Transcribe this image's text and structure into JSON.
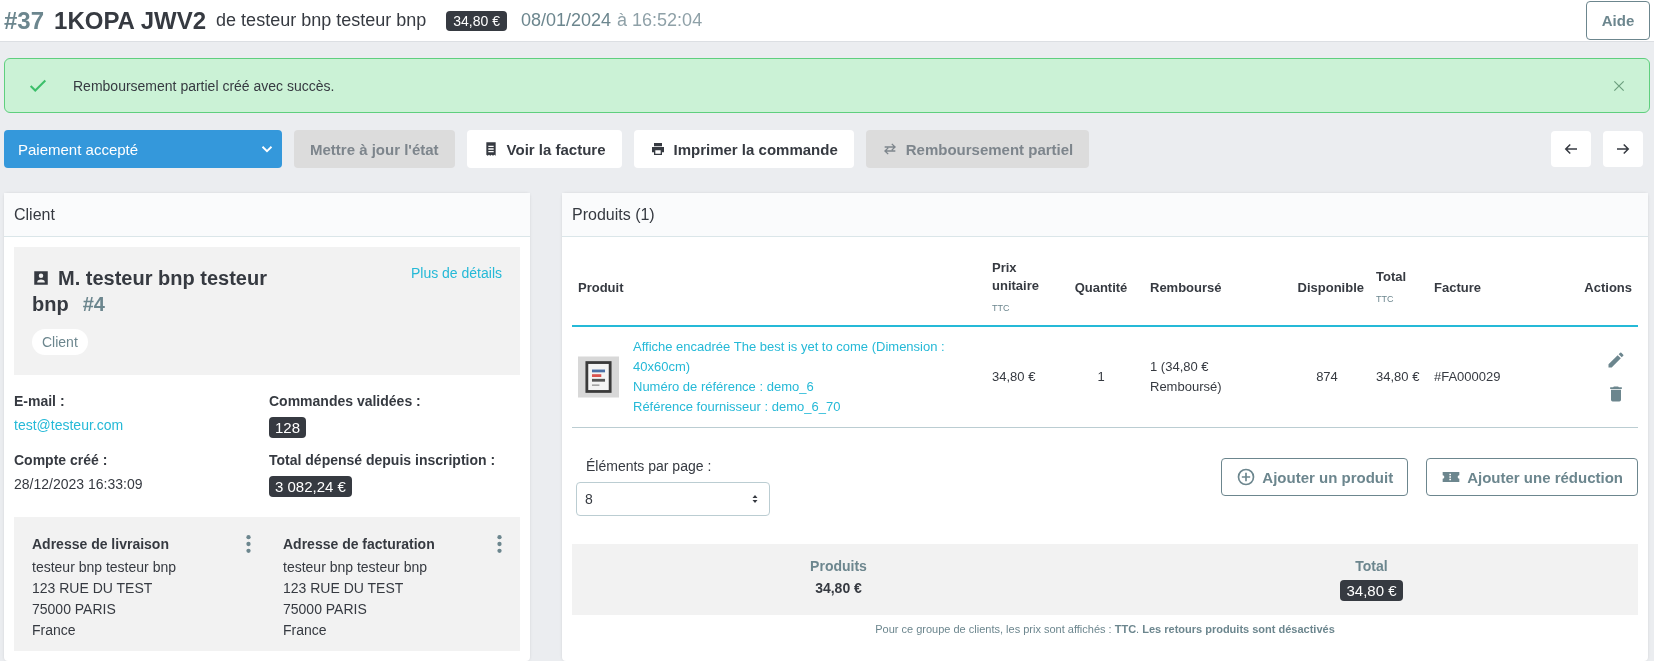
{
  "header": {
    "order_number": "#37",
    "reference": "1KOPA JWV2",
    "customer_text": "de testeur bnp testeur bnp",
    "amount": "34,80 €",
    "date": "08/01/2024",
    "time_text": "à 16:52:04",
    "help_button": "Aide"
  },
  "alert": {
    "message": "Remboursement partiel créé avec succès."
  },
  "toolbar": {
    "status_select": {
      "value": "Paiement accepté"
    },
    "buttons": [
      {
        "label": "Mettre à jour l'état",
        "kind": "plain",
        "disabled": true
      },
      {
        "label": "Voir la facture",
        "kind": "invoice",
        "disabled": false
      },
      {
        "label": "Imprimer la commande",
        "kind": "print",
        "disabled": false
      },
      {
        "label": "Remboursement partiel",
        "kind": "refund",
        "disabled": true
      }
    ]
  },
  "client_panel": {
    "title": "Client",
    "customer": {
      "name": "M. testeur bnp testeur bnp",
      "id": "#4",
      "details_link": "Plus de détails",
      "group": "Client"
    },
    "fields": [
      {
        "label": "E-mail :",
        "value": "test@testeur.com",
        "kind": "link"
      },
      {
        "label": "Commandes validées :",
        "value": "128",
        "kind": "badge"
      },
      {
        "label": "Compte créé :",
        "value": "28/12/2023 16:33:09",
        "kind": "text"
      },
      {
        "label": "Total dépensé depuis inscription :",
        "value": "3 082,24 €",
        "kind": "badge"
      }
    ],
    "addresses": [
      {
        "title": "Adresse de livraison",
        "lines": [
          "testeur bnp testeur bnp",
          "123 RUE DU TEST",
          "75000 PARIS",
          "France"
        ]
      },
      {
        "title": "Adresse de facturation",
        "lines": [
          "testeur bnp testeur bnp",
          "123 RUE DU TEST",
          "75000 PARIS",
          "France"
        ]
      }
    ]
  },
  "products_panel": {
    "title": "Produits (1)",
    "columns": [
      {
        "label": "Produit"
      },
      {
        "label": "Prix unitaire",
        "sublabel": "TTC"
      },
      {
        "label": "Quantité"
      },
      {
        "label": "Remboursé"
      },
      {
        "label": "Disponible"
      },
      {
        "label": "Total",
        "sublabel": "TTC"
      },
      {
        "label": "Facture"
      },
      {
        "label": "Actions"
      }
    ],
    "rows": [
      {
        "name": "Affiche encadrée The best is yet to come (Dimension : 40x60cm)",
        "reference": "Numéro de référence : demo_6",
        "supplier_reference": "Référence fournisseur : demo_6_70",
        "unit_price": "34,80 €",
        "quantity": "1",
        "refunded": "1 (34,80 € Remboursé)",
        "available": "874",
        "total": "34,80 €",
        "invoice": "#FA000029"
      }
    ],
    "per_page": {
      "label": "Éléments par page :",
      "value": "8"
    },
    "actions": [
      {
        "label": "Ajouter un produit",
        "kind": "add"
      },
      {
        "label": "Ajouter une réduction",
        "kind": "discount"
      }
    ],
    "summary": {
      "products_label": "Produits",
      "products_value": "34,80 €",
      "total_label": "Total",
      "total_value": "34,80 €"
    },
    "footnote": "Pour ce groupe de clients, les prix sont affichés : **TTC**. **Les retours produits sont désactivés**"
  }
}
